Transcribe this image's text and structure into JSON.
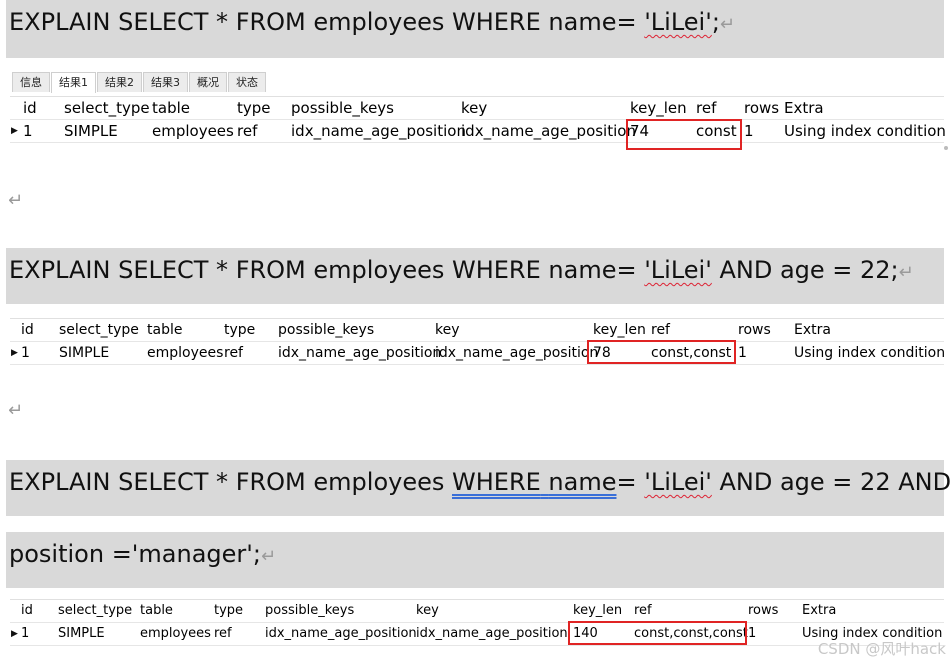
{
  "query1": {
    "sql": "EXPLAIN SELECT * FROM employees WHERE name= ",
    "literal": "'LiLei'",
    "tail": ";"
  },
  "query2": {
    "sql": "EXPLAIN SELECT * FROM employees WHERE name= ",
    "literal": "'LiLei'",
    "tail": " AND age = 22;"
  },
  "query3": {
    "part1": "EXPLAIN SELECT * FROM employees ",
    "where": "WHERE",
    "gap": " ",
    "name_kw": "name",
    "part2": "= ",
    "literal": "'LiLei'",
    "part3": " AND  age = 22 AND",
    "line2": "position ='manager';"
  },
  "pilcrow": "↵",
  "tabs": [
    "信息",
    "结果1",
    "结果2",
    "结果3",
    "概况",
    "状态"
  ],
  "columns": [
    "id",
    "select_type",
    "table",
    "type",
    "possible_keys",
    "key",
    "key_len",
    "ref",
    "rows",
    "Extra"
  ],
  "row_marker": "▶",
  "result1": [
    "1",
    "SIMPLE",
    "employees",
    "ref",
    "idx_name_age_position",
    "idx_name_age_position",
    "74",
    "const",
    "1",
    "Using index condition"
  ],
  "result2": [
    "1",
    "SIMPLE",
    "employees",
    "ref",
    "idx_name_age_position",
    "idx_name_age_position",
    "78",
    "const,const",
    "1",
    "Using index condition"
  ],
  "result3": [
    "1",
    "SIMPLE",
    "employees",
    "ref",
    "idx_name_age_position",
    "idx_name_age_position",
    "140",
    "const,const,const",
    "1",
    "Using index condition"
  ],
  "watermark": "CSDN @风叶hack"
}
